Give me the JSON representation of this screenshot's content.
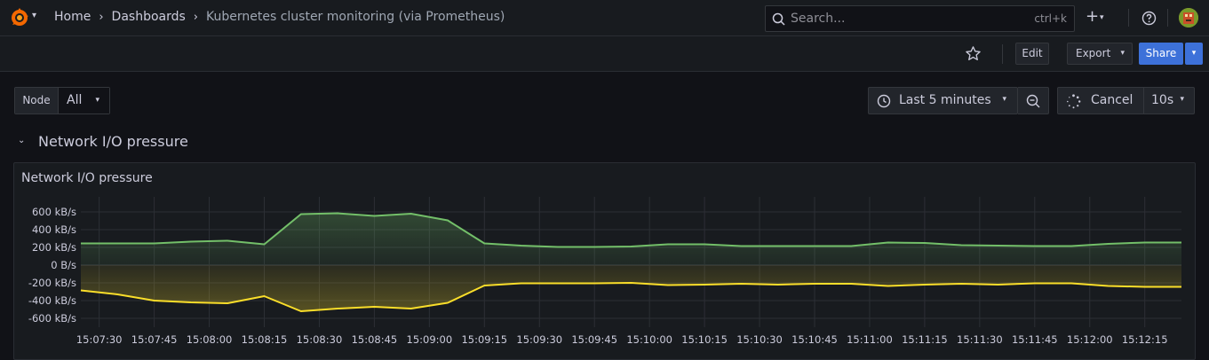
{
  "header": {
    "breadcrumbs": [
      "Home",
      "Dashboards",
      "Kubernetes cluster monitoring (via Prometheus)"
    ],
    "search": {
      "placeholder": "Search...",
      "shortcut": "ctrl+k"
    },
    "new_icon": "plus-icon",
    "help_icon": "help-icon"
  },
  "toolbar": {
    "star_icon": "star-icon",
    "edit_label": "Edit",
    "export_label": "Export",
    "share_label": "Share"
  },
  "variables": {
    "node": {
      "label": "Node",
      "value": "All"
    }
  },
  "time_controls": {
    "range_label": "Last 5 minutes",
    "cancel_label": "Cancel",
    "refresh_interval": "10s"
  },
  "row": {
    "title": "Network I/O pressure"
  },
  "panel": {
    "title": "Network I/O pressure"
  },
  "colors": {
    "received": "#73bf69",
    "transmitted": "#fade2a",
    "primary": "#3d71d9"
  },
  "chart_data": {
    "type": "area",
    "ylim": [
      -700,
      700
    ],
    "ytick_values": [
      600,
      400,
      200,
      0,
      -200,
      -400,
      -600
    ],
    "ytick_labels": [
      "600 kB/s",
      "400 kB/s",
      "200 kB/s",
      "0 B/s",
      "-200 kB/s",
      "-400 kB/s",
      "-600 kB/s"
    ],
    "xtick_labels": [
      "15:07:30",
      "15:07:45",
      "15:08:00",
      "15:08:15",
      "15:08:30",
      "15:08:45",
      "15:09:00",
      "15:09:15",
      "15:09:30",
      "15:09:45",
      "15:10:00",
      "15:10:15",
      "15:10:30",
      "15:10:45",
      "15:11:00",
      "15:11:15",
      "15:11:30",
      "15:11:45",
      "15:12:00",
      "15:12:15"
    ],
    "x_seconds": [
      0,
      10,
      20,
      30,
      40,
      50,
      60,
      70,
      80,
      90,
      100,
      110,
      120,
      130,
      140,
      150,
      160,
      170,
      180,
      190,
      200,
      210,
      220,
      230,
      240,
      250,
      260,
      270,
      280,
      290,
      300
    ],
    "series": [
      {
        "values": [
          245,
          245,
          245,
          265,
          275,
          235,
          575,
          585,
          555,
          580,
          505,
          245,
          220,
          205,
          205,
          210,
          235,
          235,
          215,
          215,
          215,
          215,
          255,
          250,
          225,
          220,
          215,
          215,
          240,
          255,
          255
        ]
      },
      {
        "values": [
          -285,
          -330,
          -400,
          -420,
          -430,
          -350,
          -520,
          -490,
          -470,
          -490,
          -425,
          -230,
          -205,
          -205,
          -205,
          -200,
          -225,
          -220,
          -210,
          -220,
          -210,
          -210,
          -235,
          -220,
          -210,
          -220,
          -205,
          -205,
          -235,
          -245,
          -245
        ]
      }
    ]
  }
}
